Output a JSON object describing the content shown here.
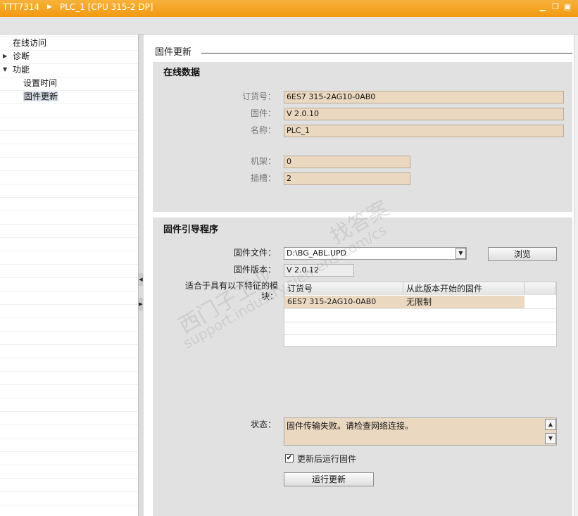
{
  "titlebar": {
    "project": "TTT7314",
    "device": "PLC_1 [CPU 315-2 DP]",
    "accent": "#f5a623"
  },
  "tree": {
    "items": [
      {
        "label": "在线访问"
      },
      {
        "label": "诊断",
        "expander": "collapsed"
      },
      {
        "label": "功能",
        "expander": "expanded"
      },
      {
        "label": "设置时间"
      },
      {
        "label": "固件更新",
        "selected": true
      }
    ]
  },
  "content": {
    "section_title": "固件更新",
    "online_data": {
      "title": "在线数据",
      "order_no_label": "订货号：",
      "order_no": "6ES7 315-2AG10-0AB0",
      "firmware_label": "固件：",
      "firmware": "V 2.0.10",
      "name_label": "名称：",
      "name": "PLC_1",
      "rack_label": "机架：",
      "rack": "0",
      "slot_label": "插槽：",
      "slot": "2"
    },
    "loader": {
      "title": "固件引导程序",
      "file_label": "固件文件：",
      "file_value": "D:\\BG_ABL.UPD",
      "browse_label": "浏览",
      "version_label": "固件版本：",
      "version_value": "V 2.0.12",
      "suitable_label": "适合于具有以下特征的模块：",
      "table": {
        "columns": [
          "订货号",
          "从此版本开始的固件"
        ],
        "rows": [
          [
            "6ES7 315-2AG10-0AB0",
            "无限制"
          ]
        ]
      },
      "status_label": "状态：",
      "status_text": "固件传输失败。请检查网络连接。",
      "run_after_update_label": "更新后运行固件",
      "run_after_update_checked": true,
      "run_update_label": "运行更新"
    }
  },
  "watermark": {
    "line1": "西门子工业",
    "line2": "support.industry.siemens.com/cs",
    "line3": "找答案"
  }
}
